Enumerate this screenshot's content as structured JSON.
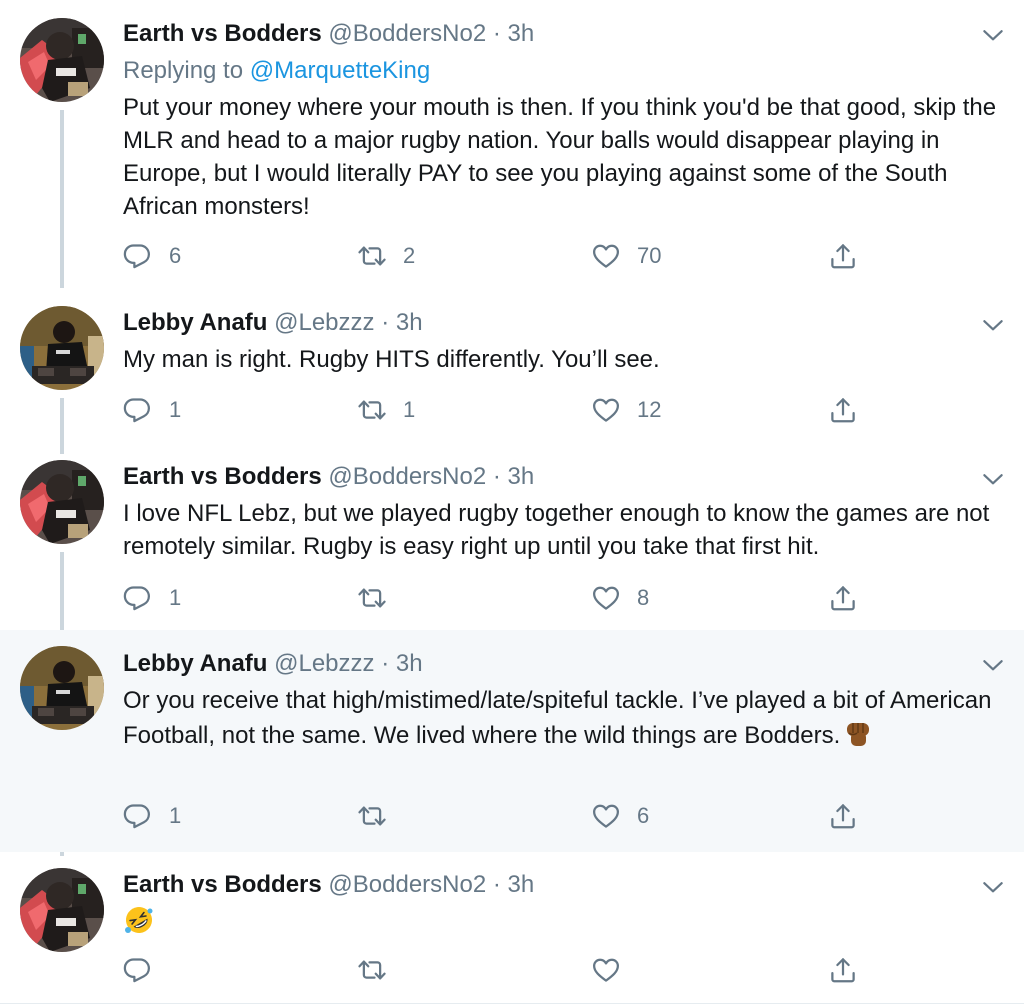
{
  "tweets": [
    {
      "name": "Earth vs Bodders",
      "handle": "@BoddersNo2",
      "dot": "·",
      "time": "3h",
      "replying_prefix": "Replying to ",
      "replying_to": "@MarquetteKing",
      "text": "Put your money where your mouth is then. If you think you'd be that good, skip the MLR and head to a major rugby nation. Your balls would disappear playing in Europe, but I would literally PAY to see you playing against some of the South African monsters!",
      "replies": "6",
      "retweets": "2",
      "likes": "70"
    },
    {
      "name": "Lebby Anafu",
      "handle": "@Lebzzz",
      "dot": "·",
      "time": "3h",
      "text": "My man is right. Rugby HITS differently. You’ll see.",
      "replies": "1",
      "retweets": "1",
      "likes": "12"
    },
    {
      "name": "Earth vs Bodders",
      "handle": "@BoddersNo2",
      "dot": "·",
      "time": "3h",
      "text": "I love NFL Lebz, but we played rugby together enough to know the games are not remotely similar. Rugby is easy right up until you take that first hit.",
      "replies": "1",
      "retweets": "",
      "likes": "8"
    },
    {
      "name": "Lebby Anafu",
      "handle": "@Lebzzz",
      "dot": "·",
      "time": "3h",
      "text": "Or you receive that high/mistimed/late/spiteful tackle. I’ve played a bit of American Football, not the same. We lived where the wild things are Bodders.",
      "emoji": "raised-fist-medium-dark-skin",
      "replies": "1",
      "retweets": "",
      "likes": "6"
    },
    {
      "name": "Earth vs Bodders",
      "handle": "@BoddersNo2",
      "dot": "·",
      "time": "3h",
      "text": "",
      "emoji": "rolling-on-floor-laughing",
      "replies": "",
      "retweets": "",
      "likes": ""
    }
  ],
  "colors": {
    "name": "#14171a",
    "secondary": "#657786",
    "link": "#1b95e0",
    "thread_line": "#ccd6dd",
    "highlight_bg": "#f5f8fa"
  },
  "icons": [
    "reply-icon",
    "retweet-icon",
    "like-icon",
    "share-icon",
    "chevron-down-icon"
  ]
}
